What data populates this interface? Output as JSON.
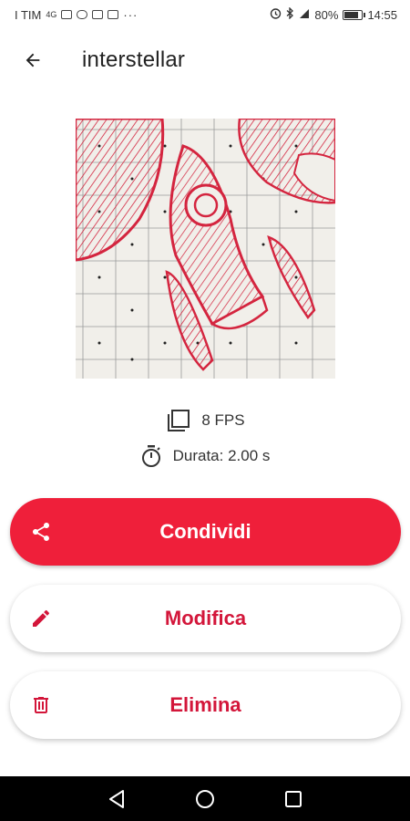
{
  "status_bar": {
    "carrier": "I TIM",
    "network": "4G",
    "battery_percent": "80%",
    "time": "14:55"
  },
  "app_bar": {
    "back_icon": "arrow-back-icon",
    "title": "interstellar"
  },
  "preview": {
    "icon": "rocket-drawing-image"
  },
  "info": {
    "fps_icon": "frames-icon",
    "fps": "8 FPS",
    "duration_icon": "stopwatch-icon",
    "duration": "Durata: 2.00 s"
  },
  "actions": {
    "share_label": "Condividi",
    "share_icon": "share-icon",
    "edit_label": "Modifica",
    "edit_icon": "pencil-icon",
    "delete_label": "Elimina",
    "delete_icon": "trash-icon"
  },
  "colors": {
    "primary": "#ef1f3a",
    "accent_text": "#d3163a"
  },
  "nav": {
    "back": "nav-back-icon",
    "home": "nav-home-icon",
    "recents": "nav-recents-icon"
  }
}
